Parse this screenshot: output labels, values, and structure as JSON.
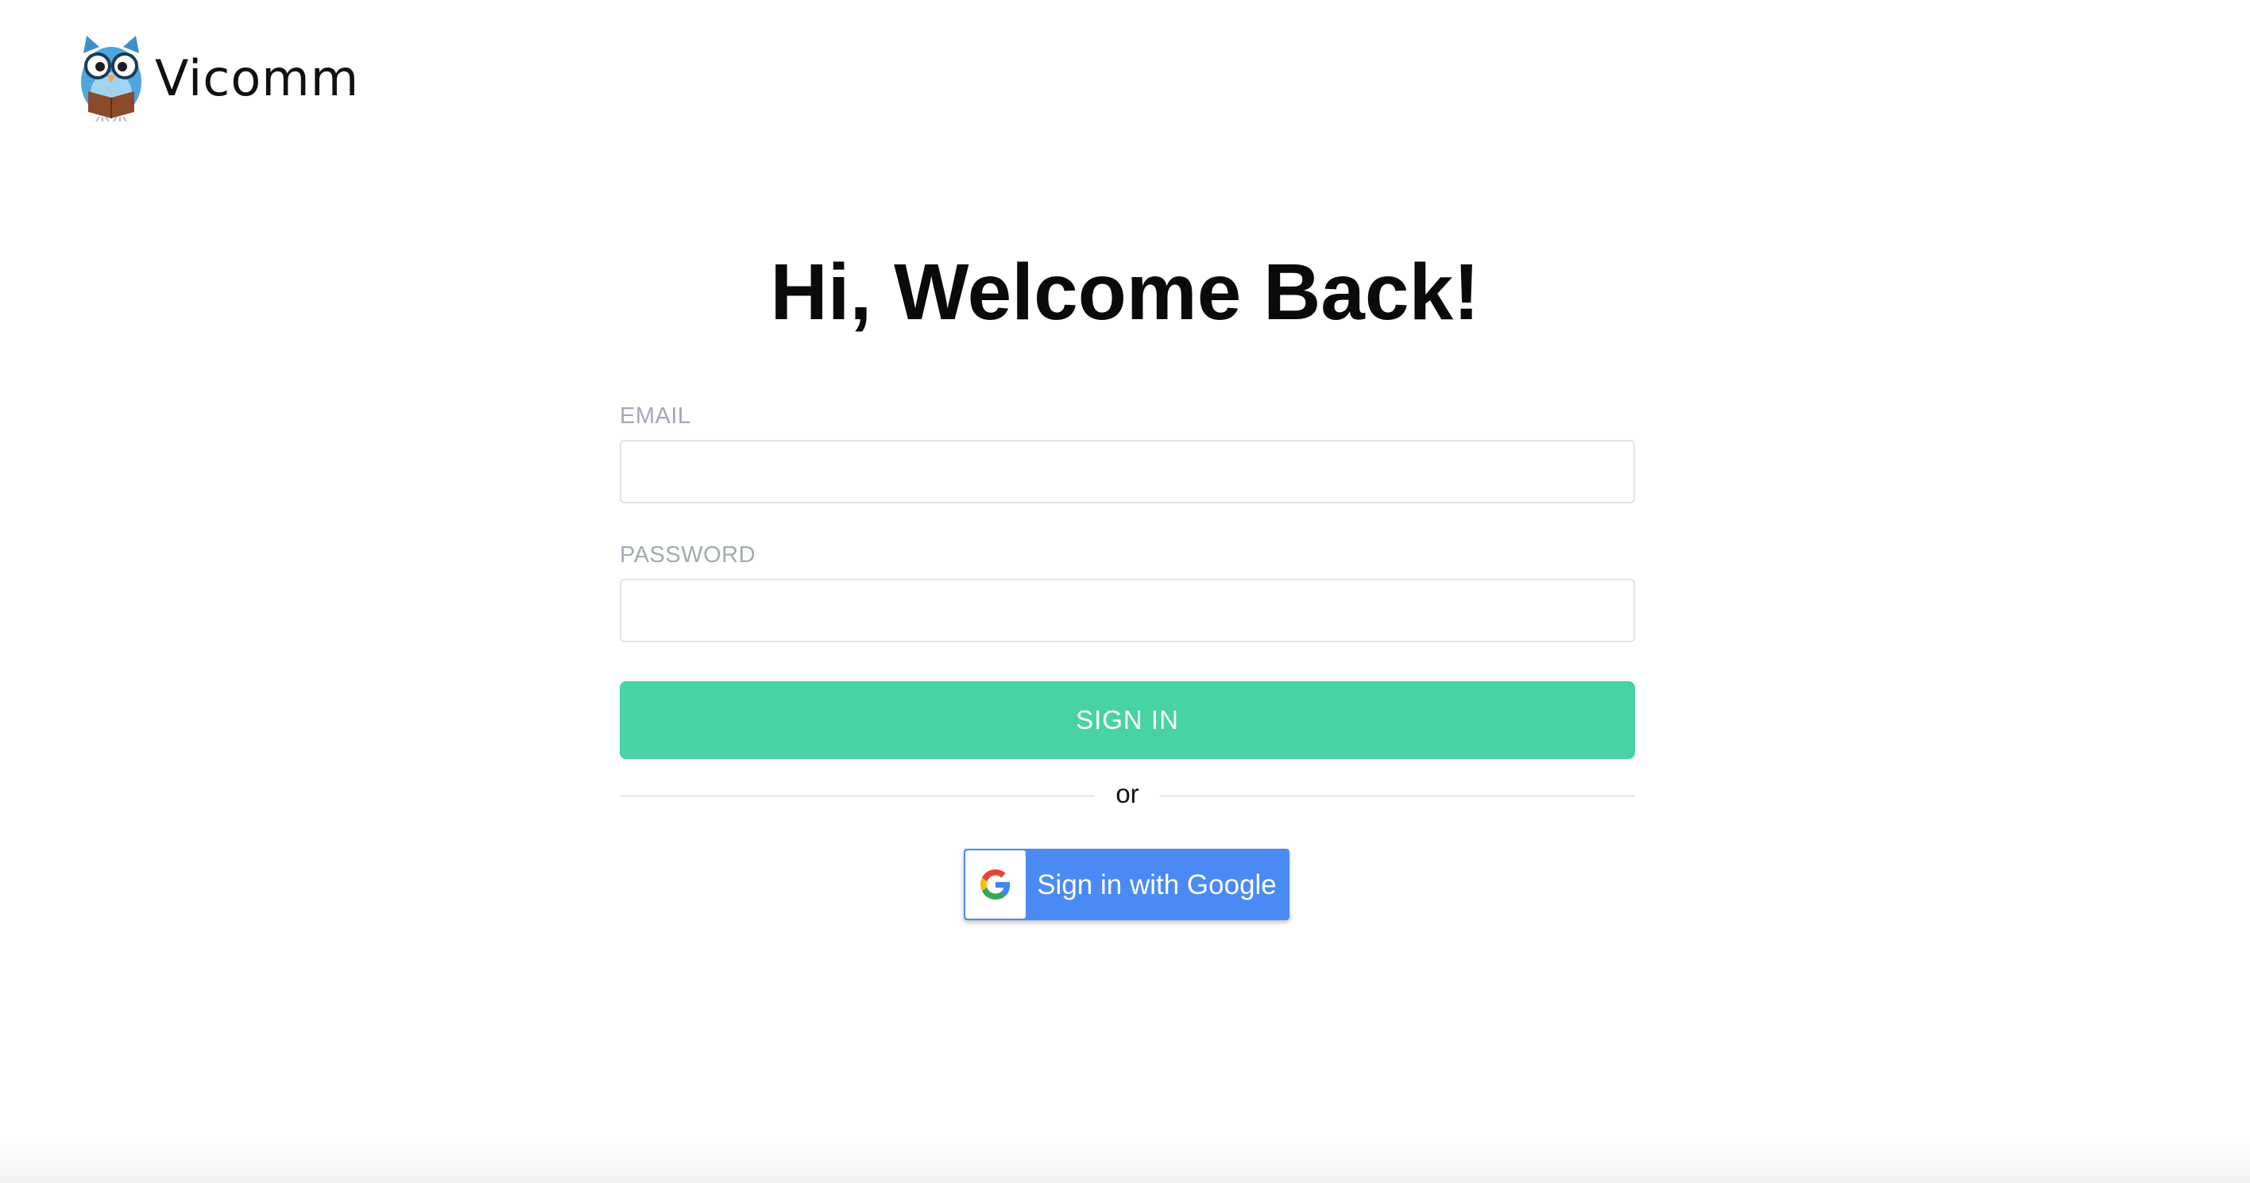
{
  "brand": {
    "name": "Vicomm",
    "logo_icon": "owl-icon"
  },
  "headline": "Hi, Welcome Back!",
  "form": {
    "email_label": "EMAIL",
    "email_value": "",
    "password_label": "PASSWORD",
    "password_value": "",
    "submit_label": "SIGN IN",
    "divider_text": "or"
  },
  "google": {
    "label": "Sign in with Google",
    "icon": "google-g-icon"
  },
  "colors": {
    "primary_button": "#47d3a4",
    "google_button": "#4a8af4",
    "label_text": "#a0a9b8"
  }
}
